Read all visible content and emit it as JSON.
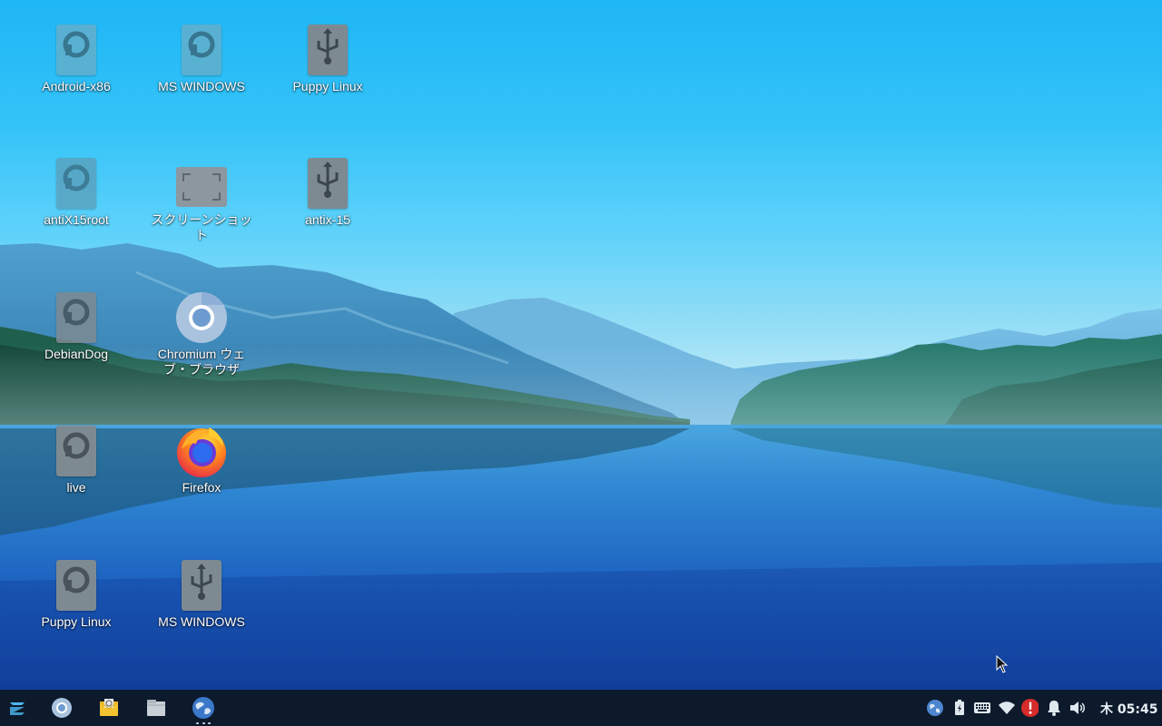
{
  "desktop": {
    "icons": [
      {
        "label": "Android-x86",
        "icon": "drive-icon"
      },
      {
        "label": "MS WINDOWS",
        "icon": "drive-icon"
      },
      {
        "label": "Puppy Linux",
        "icon": "usb-drive-icon"
      },
      {
        "label": "antiX15root",
        "icon": "drive-icon"
      },
      {
        "label": "スクリーンショット",
        "icon": "screenshot-folder-icon"
      },
      {
        "label": "antix-15",
        "icon": "usb-drive-icon"
      },
      {
        "label": "DebianDog",
        "icon": "drive-icon"
      },
      {
        "label": "Chromium ウェブ・ブラウザ",
        "icon": "chromium-icon"
      },
      {
        "label": "live",
        "icon": "drive-icon"
      },
      {
        "label": "Firefox",
        "icon": "firefox-icon"
      },
      {
        "label": "Puppy Linux",
        "icon": "drive-icon"
      },
      {
        "label": "MS WINDOWS",
        "icon": "usb-drive-icon"
      }
    ]
  },
  "taskbar": {
    "launchers": [
      {
        "icon": "zorin-menu-icon"
      },
      {
        "icon": "chromium-icon"
      },
      {
        "icon": "mail-icon"
      },
      {
        "icon": "files-icon"
      },
      {
        "icon": "web-browser-icon"
      }
    ],
    "tray": [
      {
        "icon": "network-globe-icon"
      },
      {
        "icon": "battery-icon"
      },
      {
        "icon": "keyboard-icon"
      },
      {
        "icon": "wifi-icon"
      },
      {
        "icon": "alert-icon"
      },
      {
        "icon": "notifications-bell-icon"
      },
      {
        "icon": "volume-icon"
      }
    ],
    "clock": "木 05:45"
  },
  "colors": {
    "taskbar_bg": "#0c1a2c",
    "alert_red": "#d62b2b",
    "sky_blue": "#33c3f8",
    "lake_blue": "#1f64c2"
  }
}
